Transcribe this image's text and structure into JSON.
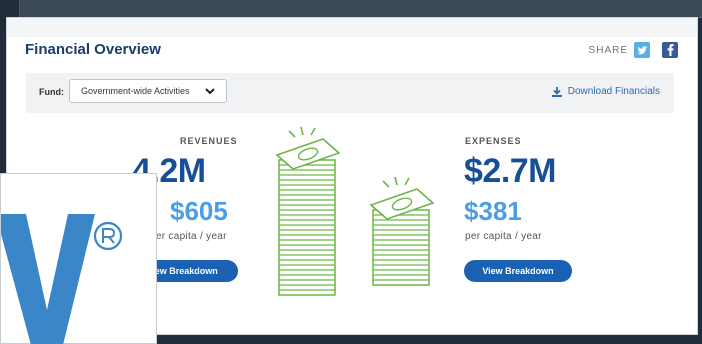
{
  "colors": {
    "title": "#1d3b6b",
    "amount": "#174f96",
    "per_capita": "#4a9ee6",
    "button": "#1b61b3",
    "money": "#6cb646"
  },
  "header": {
    "title": "Financial Overview",
    "share_label": "SHARE"
  },
  "fund": {
    "label": "Fund:",
    "selected": "Government-wide Activities",
    "download_label": "Download Financials"
  },
  "revenues": {
    "label": "REVENUES",
    "total": "4.2M",
    "per_capita_amount": "$605",
    "per_capita_label": "per capita / year",
    "button": "iew Breakdown"
  },
  "expenses": {
    "label": "EXPENSES",
    "total": "$2.7M",
    "per_capita_amount": "$381",
    "per_capita_label": "per capita / year",
    "button": "View Breakdown"
  },
  "icons": [
    "twitter-icon",
    "facebook-icon",
    "download-icon",
    "chevron-down-icon",
    "money-stack-icon"
  ]
}
